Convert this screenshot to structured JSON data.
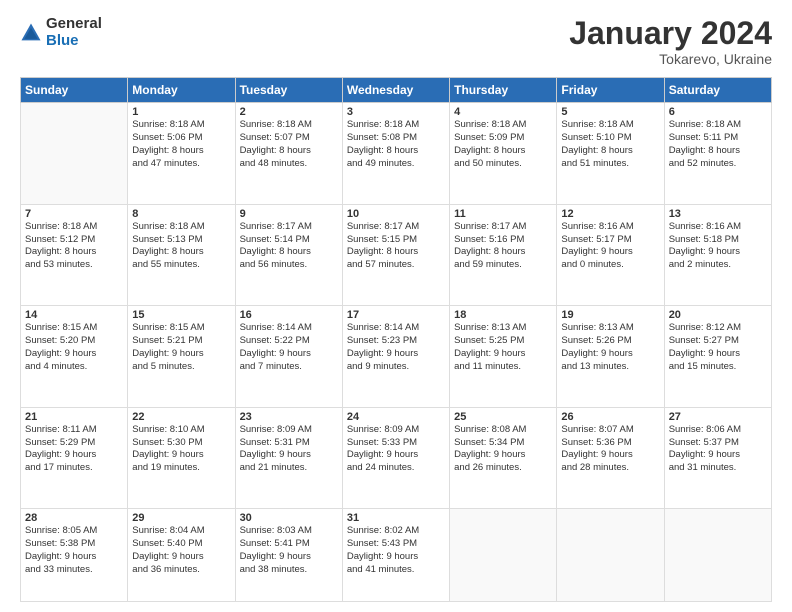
{
  "logo": {
    "general": "General",
    "blue": "Blue"
  },
  "title": "January 2024",
  "location": "Tokarevo, Ukraine",
  "days_of_week": [
    "Sunday",
    "Monday",
    "Tuesday",
    "Wednesday",
    "Thursday",
    "Friday",
    "Saturday"
  ],
  "weeks": [
    [
      {
        "day": "",
        "lines": []
      },
      {
        "day": "1",
        "lines": [
          "Sunrise: 8:18 AM",
          "Sunset: 5:06 PM",
          "Daylight: 8 hours",
          "and 47 minutes."
        ]
      },
      {
        "day": "2",
        "lines": [
          "Sunrise: 8:18 AM",
          "Sunset: 5:07 PM",
          "Daylight: 8 hours",
          "and 48 minutes."
        ]
      },
      {
        "day": "3",
        "lines": [
          "Sunrise: 8:18 AM",
          "Sunset: 5:08 PM",
          "Daylight: 8 hours",
          "and 49 minutes."
        ]
      },
      {
        "day": "4",
        "lines": [
          "Sunrise: 8:18 AM",
          "Sunset: 5:09 PM",
          "Daylight: 8 hours",
          "and 50 minutes."
        ]
      },
      {
        "day": "5",
        "lines": [
          "Sunrise: 8:18 AM",
          "Sunset: 5:10 PM",
          "Daylight: 8 hours",
          "and 51 minutes."
        ]
      },
      {
        "day": "6",
        "lines": [
          "Sunrise: 8:18 AM",
          "Sunset: 5:11 PM",
          "Daylight: 8 hours",
          "and 52 minutes."
        ]
      }
    ],
    [
      {
        "day": "7",
        "lines": [
          "Sunrise: 8:18 AM",
          "Sunset: 5:12 PM",
          "Daylight: 8 hours",
          "and 53 minutes."
        ]
      },
      {
        "day": "8",
        "lines": [
          "Sunrise: 8:18 AM",
          "Sunset: 5:13 PM",
          "Daylight: 8 hours",
          "and 55 minutes."
        ]
      },
      {
        "day": "9",
        "lines": [
          "Sunrise: 8:17 AM",
          "Sunset: 5:14 PM",
          "Daylight: 8 hours",
          "and 56 minutes."
        ]
      },
      {
        "day": "10",
        "lines": [
          "Sunrise: 8:17 AM",
          "Sunset: 5:15 PM",
          "Daylight: 8 hours",
          "and 57 minutes."
        ]
      },
      {
        "day": "11",
        "lines": [
          "Sunrise: 8:17 AM",
          "Sunset: 5:16 PM",
          "Daylight: 8 hours",
          "and 59 minutes."
        ]
      },
      {
        "day": "12",
        "lines": [
          "Sunrise: 8:16 AM",
          "Sunset: 5:17 PM",
          "Daylight: 9 hours",
          "and 0 minutes."
        ]
      },
      {
        "day": "13",
        "lines": [
          "Sunrise: 8:16 AM",
          "Sunset: 5:18 PM",
          "Daylight: 9 hours",
          "and 2 minutes."
        ]
      }
    ],
    [
      {
        "day": "14",
        "lines": [
          "Sunrise: 8:15 AM",
          "Sunset: 5:20 PM",
          "Daylight: 9 hours",
          "and 4 minutes."
        ]
      },
      {
        "day": "15",
        "lines": [
          "Sunrise: 8:15 AM",
          "Sunset: 5:21 PM",
          "Daylight: 9 hours",
          "and 5 minutes."
        ]
      },
      {
        "day": "16",
        "lines": [
          "Sunrise: 8:14 AM",
          "Sunset: 5:22 PM",
          "Daylight: 9 hours",
          "and 7 minutes."
        ]
      },
      {
        "day": "17",
        "lines": [
          "Sunrise: 8:14 AM",
          "Sunset: 5:23 PM",
          "Daylight: 9 hours",
          "and 9 minutes."
        ]
      },
      {
        "day": "18",
        "lines": [
          "Sunrise: 8:13 AM",
          "Sunset: 5:25 PM",
          "Daylight: 9 hours",
          "and 11 minutes."
        ]
      },
      {
        "day": "19",
        "lines": [
          "Sunrise: 8:13 AM",
          "Sunset: 5:26 PM",
          "Daylight: 9 hours",
          "and 13 minutes."
        ]
      },
      {
        "day": "20",
        "lines": [
          "Sunrise: 8:12 AM",
          "Sunset: 5:27 PM",
          "Daylight: 9 hours",
          "and 15 minutes."
        ]
      }
    ],
    [
      {
        "day": "21",
        "lines": [
          "Sunrise: 8:11 AM",
          "Sunset: 5:29 PM",
          "Daylight: 9 hours",
          "and 17 minutes."
        ]
      },
      {
        "day": "22",
        "lines": [
          "Sunrise: 8:10 AM",
          "Sunset: 5:30 PM",
          "Daylight: 9 hours",
          "and 19 minutes."
        ]
      },
      {
        "day": "23",
        "lines": [
          "Sunrise: 8:09 AM",
          "Sunset: 5:31 PM",
          "Daylight: 9 hours",
          "and 21 minutes."
        ]
      },
      {
        "day": "24",
        "lines": [
          "Sunrise: 8:09 AM",
          "Sunset: 5:33 PM",
          "Daylight: 9 hours",
          "and 24 minutes."
        ]
      },
      {
        "day": "25",
        "lines": [
          "Sunrise: 8:08 AM",
          "Sunset: 5:34 PM",
          "Daylight: 9 hours",
          "and 26 minutes."
        ]
      },
      {
        "day": "26",
        "lines": [
          "Sunrise: 8:07 AM",
          "Sunset: 5:36 PM",
          "Daylight: 9 hours",
          "and 28 minutes."
        ]
      },
      {
        "day": "27",
        "lines": [
          "Sunrise: 8:06 AM",
          "Sunset: 5:37 PM",
          "Daylight: 9 hours",
          "and 31 minutes."
        ]
      }
    ],
    [
      {
        "day": "28",
        "lines": [
          "Sunrise: 8:05 AM",
          "Sunset: 5:38 PM",
          "Daylight: 9 hours",
          "and 33 minutes."
        ]
      },
      {
        "day": "29",
        "lines": [
          "Sunrise: 8:04 AM",
          "Sunset: 5:40 PM",
          "Daylight: 9 hours",
          "and 36 minutes."
        ]
      },
      {
        "day": "30",
        "lines": [
          "Sunrise: 8:03 AM",
          "Sunset: 5:41 PM",
          "Daylight: 9 hours",
          "and 38 minutes."
        ]
      },
      {
        "day": "31",
        "lines": [
          "Sunrise: 8:02 AM",
          "Sunset: 5:43 PM",
          "Daylight: 9 hours",
          "and 41 minutes."
        ]
      },
      {
        "day": "",
        "lines": []
      },
      {
        "day": "",
        "lines": []
      },
      {
        "day": "",
        "lines": []
      }
    ]
  ]
}
